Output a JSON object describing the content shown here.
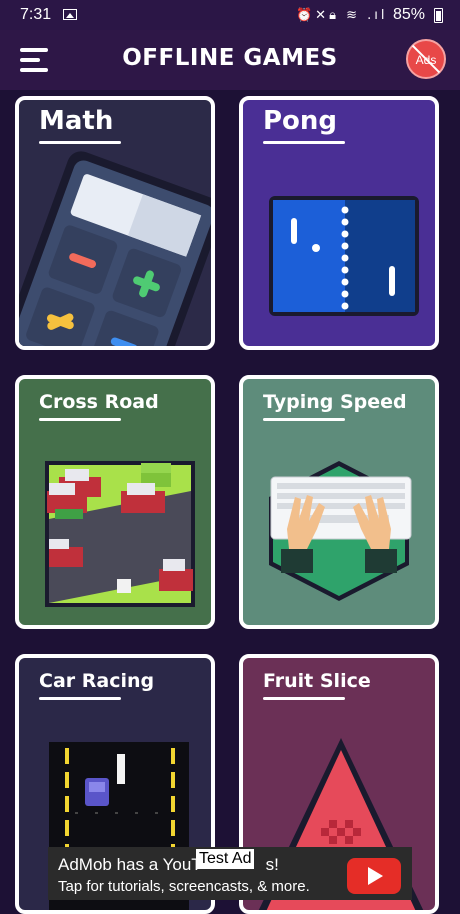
{
  "status_bar": {
    "time": "7:31",
    "icons": [
      "image-icon",
      "alarm-icon",
      "mute-icon",
      "lock-icon",
      "wifi-icon",
      "signal-icon"
    ],
    "battery": "85%"
  },
  "app_bar": {
    "title": "OFFLINE GAMES",
    "no_ads_label": "Ads"
  },
  "games": [
    {
      "label": "Math"
    },
    {
      "label": "Pong"
    },
    {
      "label": "Cross Road"
    },
    {
      "label": "Typing Speed"
    },
    {
      "label": "Car Racing"
    },
    {
      "label": "Fruit Slice"
    }
  ],
  "ad": {
    "line1": "AdMob has a YouT",
    "line1_tail": "s!",
    "line2": "Tap for tutorials, screencasts, & more.",
    "test_label": "Test Ad"
  },
  "colors": {
    "background": "#1d1135",
    "app_bar": "#2e1747",
    "no_ads": "#e84848"
  }
}
